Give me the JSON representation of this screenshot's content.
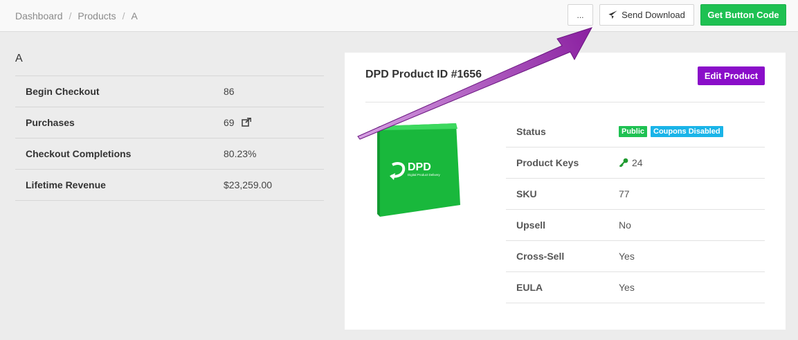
{
  "breadcrumb": {
    "items": [
      "Dashboard",
      "Products",
      "A"
    ]
  },
  "toolbar": {
    "more_label": "...",
    "send_download_label": "Send Download",
    "get_button_code_label": "Get Button Code"
  },
  "left": {
    "title": "A",
    "stats": [
      {
        "label": "Begin Checkout",
        "value": "86"
      },
      {
        "label": "Purchases",
        "value": "69"
      },
      {
        "label": "Checkout Completions",
        "value": "80.23%"
      },
      {
        "label": "Lifetime Revenue",
        "value": "$23,259.00"
      }
    ]
  },
  "card": {
    "title": "DPD Product ID #1656",
    "edit_label": "Edit Product",
    "product_image_logo": "DPD",
    "product_image_tagline": "Digital Product Delivery",
    "details": {
      "status_label": "Status",
      "status_badges": [
        "Public",
        "Coupons Disabled"
      ],
      "product_keys_label": "Product Keys",
      "product_keys_value": "24",
      "sku_label": "SKU",
      "sku_value": "77",
      "upsell_label": "Upsell",
      "upsell_value": "No",
      "cross_sell_label": "Cross-Sell",
      "cross_sell_value": "Yes",
      "eula_label": "EULA",
      "eula_value": "Yes"
    }
  },
  "colors": {
    "green": "#1ec152",
    "purple": "#8a0ec9",
    "blue_badge": "#1ab4e8",
    "arrow": "#a030b0"
  },
  "icons": [
    "send-icon",
    "external-link-icon",
    "key-icon",
    "annotation-arrow"
  ]
}
